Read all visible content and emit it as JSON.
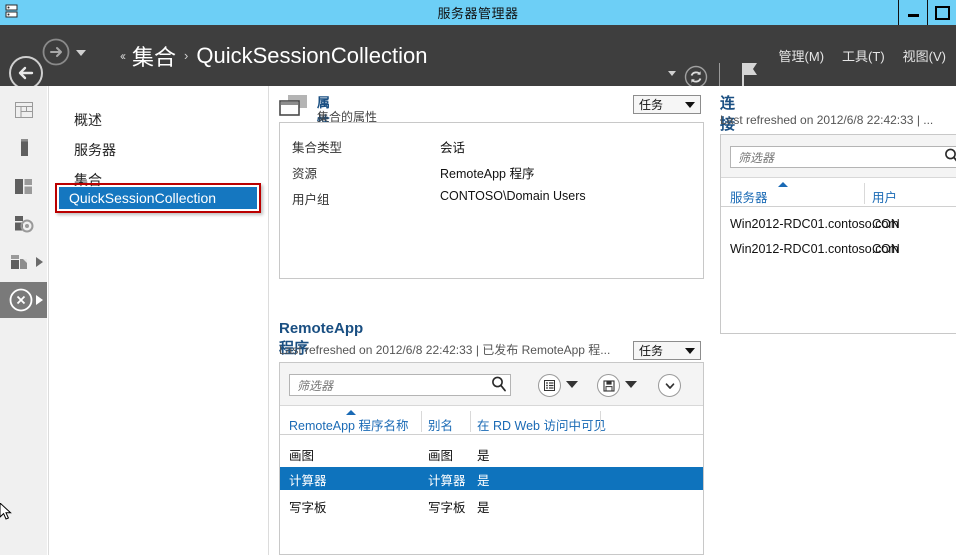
{
  "window": {
    "title": "服务器管理器",
    "minimize_label": "最小化",
    "maximize_label": "最大化"
  },
  "header": {
    "back_label": "后退",
    "forward_label": "前进",
    "history_label": "历史记录",
    "breadcrumb_prev": "‹‹",
    "breadcrumb": [
      "集合",
      "QuickSessionCollection"
    ],
    "breadcrumb_separator": "›",
    "refresh_label": "刷新",
    "notifications_label": "通知",
    "menus": [
      "管理(M)",
      "工具(T)",
      "视图(V)"
    ]
  },
  "rail": {
    "items": [
      {
        "name": "dashboard-icon",
        "label": "仪表板",
        "selected": false,
        "has_arrow": false
      },
      {
        "name": "local-server-icon",
        "label": "本地服务器",
        "selected": false,
        "has_arrow": false
      },
      {
        "name": "all-servers-icon",
        "label": "所有服务器",
        "selected": false,
        "has_arrow": false
      },
      {
        "name": "file-services-icon",
        "label": "文件和存储服务",
        "selected": false,
        "has_arrow": false
      },
      {
        "name": "collections-icon",
        "label": "集合",
        "selected": false,
        "has_arrow": true
      },
      {
        "name": "remote-desktop-icon",
        "label": "远程桌面服务",
        "selected": true,
        "has_arrow": true
      }
    ]
  },
  "nav": {
    "items": [
      {
        "label": "概述",
        "selected": false
      },
      {
        "label": "服务器",
        "selected": false
      },
      {
        "label": "集合",
        "selected": false
      }
    ],
    "selected_item": "QuickSessionCollection"
  },
  "properties_panel": {
    "title": "属性",
    "subtitle": "集合的属性",
    "tasks_label": "任务",
    "rows": [
      {
        "label": "集合类型",
        "value": "会话"
      },
      {
        "label": "资源",
        "value": "RemoteApp 程序"
      },
      {
        "label": "用户组",
        "value": "CONTOSO\\Domain Users"
      }
    ]
  },
  "remoteapp_panel": {
    "title": "RemoteApp 程序",
    "subtitle": "Last refreshed on 2012/6/8 22:42:33 | 已发布 RemoteApp 程...",
    "tasks_label": "任务",
    "filter_placeholder": "筛选器",
    "filter_value": "",
    "toolbar_buttons": [
      {
        "name": "query-filter-button",
        "label": "查询筛选器"
      },
      {
        "name": "save-query-button",
        "label": "保存查询"
      },
      {
        "name": "expand-button",
        "label": "展开"
      }
    ],
    "columns": [
      "RemoteApp 程序名称",
      "别名",
      "在 RD Web 访问中可见"
    ],
    "sort_column": "RemoteApp 程序名称",
    "rows": [
      {
        "name": "画图",
        "alias": "画图",
        "visible": "是",
        "selected": false
      },
      {
        "name": "计算器",
        "alias": "计算器",
        "visible": "是",
        "selected": true
      },
      {
        "name": "写字板",
        "alias": "写字板",
        "visible": "是",
        "selected": false
      }
    ]
  },
  "connections_panel": {
    "title": "连接",
    "subtitle": "Last refreshed on 2012/6/8 22:42:33 | ...",
    "filter_placeholder": "筛选器",
    "filter_value": "",
    "columns": [
      "服务器",
      "用户"
    ],
    "sort_column": "服务器",
    "rows": [
      {
        "server": "Win2012-RDC01.contoso.com",
        "user": "CON"
      },
      {
        "server": "Win2012-RDC01.contoso.com",
        "user": "CON"
      }
    ]
  },
  "colors": {
    "titlebar": "#6dcff6",
    "header": "#3e3e3e",
    "accent_blue": "#1577c0",
    "selection_blue": "#0e73bd",
    "highlight_red": "#bb0000",
    "link_blue": "#1a6ab5",
    "panel_title_blue": "#1a4f82"
  }
}
